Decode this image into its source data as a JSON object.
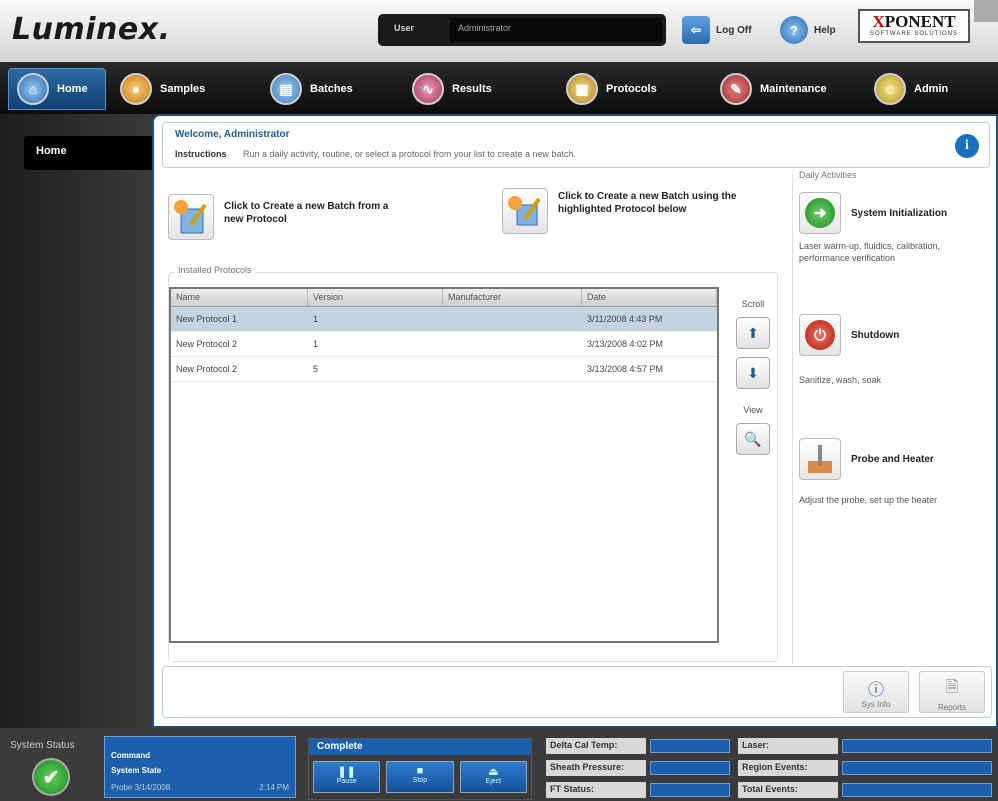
{
  "header": {
    "logo": "Luminex.",
    "user_label": "User",
    "user_value": "Administrator",
    "logoff_label": "Log Off",
    "help_label": "Help",
    "brand_main_x": "X",
    "brand_main_rest": "PONENT",
    "brand_sub": "SOFTWARE SOLUTIONS"
  },
  "nav": {
    "tabs": [
      {
        "label": "Home",
        "icon": "home-icon"
      },
      {
        "label": "Samples",
        "icon": "samples-icon"
      },
      {
        "label": "Batches",
        "icon": "batches-icon"
      },
      {
        "label": "Results",
        "icon": "results-icon"
      },
      {
        "label": "Protocols",
        "icon": "protocols-icon"
      },
      {
        "label": "Maintenance",
        "icon": "maintenance-icon"
      },
      {
        "label": "Admin",
        "icon": "admin-icon"
      }
    ],
    "active": "Home"
  },
  "sidebar": {
    "items": [
      {
        "label": "Home"
      }
    ]
  },
  "welcome": {
    "title": "Welcome, Administrator",
    "instr_label": "Instructions",
    "instr_text": "Run a daily activity, routine, or select a protocol from your list to create a new batch."
  },
  "create": {
    "new_protocol": "Click to Create a new Batch from a new Protocol",
    "highlighted": "Click to Create a new Batch using the highlighted Protocol below"
  },
  "protocols": {
    "group_label": "Installed Protocols",
    "columns": [
      "Name",
      "Version",
      "Manufacturer",
      "Date"
    ],
    "rows": [
      {
        "name": "New Protocol 1",
        "version": "1",
        "manufacturer": "",
        "date": "3/11/2008 4:43 PM"
      },
      {
        "name": "New Protocol 2",
        "version": "1",
        "manufacturer": "",
        "date": "3/13/2008 4:02 PM"
      },
      {
        "name": "New Protocol 2",
        "version": "5",
        "manufacturer": "",
        "date": "3/13/2008 4:57 PM"
      }
    ],
    "selected_row": 0,
    "scroll_label": "Scroll",
    "view_label": "View"
  },
  "daily": {
    "label": "Daily Activities",
    "items": [
      {
        "title": "System Initialization",
        "desc": "Laser warm-up, fluidics, calibration, performance verification"
      },
      {
        "title": "Shutdown",
        "desc": "Sanitize, wash, soak"
      },
      {
        "title": "Probe and Heater",
        "desc": "Adjust the probe, set up the heater"
      }
    ]
  },
  "bottom": {
    "sysinfo": "Sys Info",
    "reports": "Reports"
  },
  "status": {
    "label": "System Status",
    "command_label": "Command",
    "state_label": "System State",
    "state_value": "Probe 3/14/2008",
    "state_time": "2:14 PM",
    "complete_label": "Complete",
    "btn_pause": "Pause",
    "btn_stop": "Stop",
    "btn_eject": "Eject",
    "meters": [
      "Delta Cal Temp:",
      "Sheath Pressure:",
      "FT Status:",
      "Laser:",
      "Region Events:",
      "Total Events:"
    ]
  },
  "colors": {
    "accent": "#1b5fae",
    "selected_row": "#c5d3e2",
    "ok": "#2a9a2a"
  }
}
